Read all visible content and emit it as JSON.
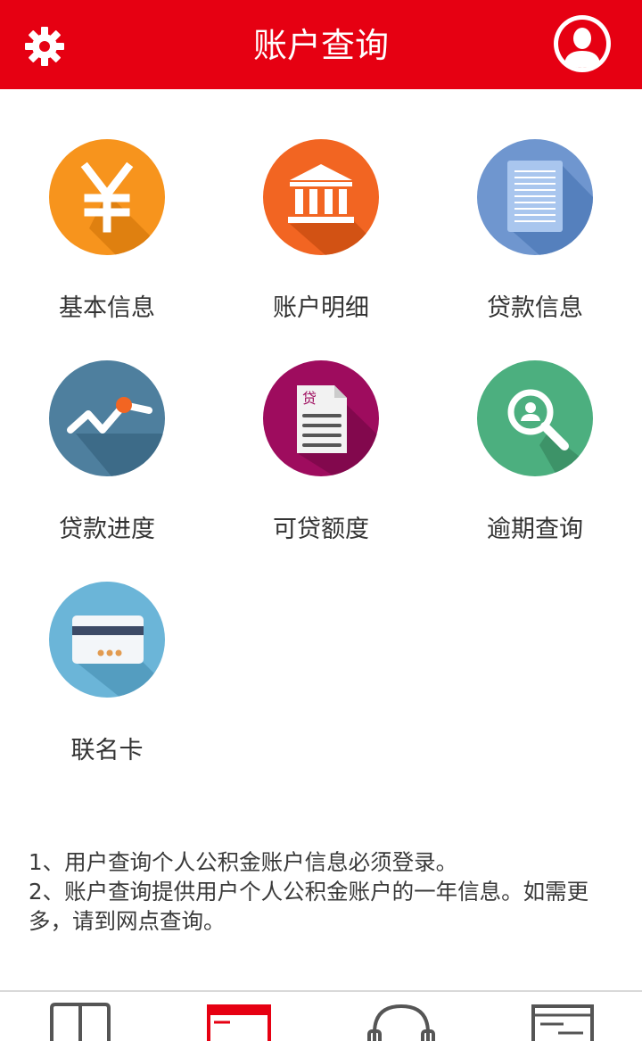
{
  "header": {
    "title": "账户查询",
    "settings_icon": "gear-icon",
    "profile_icon": "user-avatar-icon"
  },
  "colors": {
    "brand_red": "#e60012",
    "tile_basic": "#f7941d",
    "tile_detail": "#f26522",
    "tile_loan": "#6f96cf",
    "tile_progress": "#4e7f9e",
    "tile_quota": "#9e0c5e",
    "tile_overdue": "#4caf7f",
    "tile_card": "#6bb5d8"
  },
  "tiles": [
    {
      "label": "基本信息",
      "icon": "yuan-icon"
    },
    {
      "label": "账户明细",
      "icon": "bank-icon"
    },
    {
      "label": "贷款信息",
      "icon": "document-icon"
    },
    {
      "label": "贷款进度",
      "icon": "trend-line-icon"
    },
    {
      "label": "可贷额度",
      "icon": "loan-document-icon",
      "icon_text": "贷"
    },
    {
      "label": "逾期查询",
      "icon": "user-search-icon"
    },
    {
      "label": "联名卡",
      "icon": "card-icon"
    }
  ],
  "notes": [
    "1、用户查询个人公积金账户信息必须登录。",
    "2、账户查询提供用户个人公积金账户的一年信息。如需更多，请到网点查询。"
  ],
  "bottom_nav": [
    {
      "icon": "book-icon",
      "active": false
    },
    {
      "icon": "query-icon",
      "active": true
    },
    {
      "icon": "headset-icon",
      "active": false
    },
    {
      "icon": "news-icon",
      "active": false
    }
  ]
}
